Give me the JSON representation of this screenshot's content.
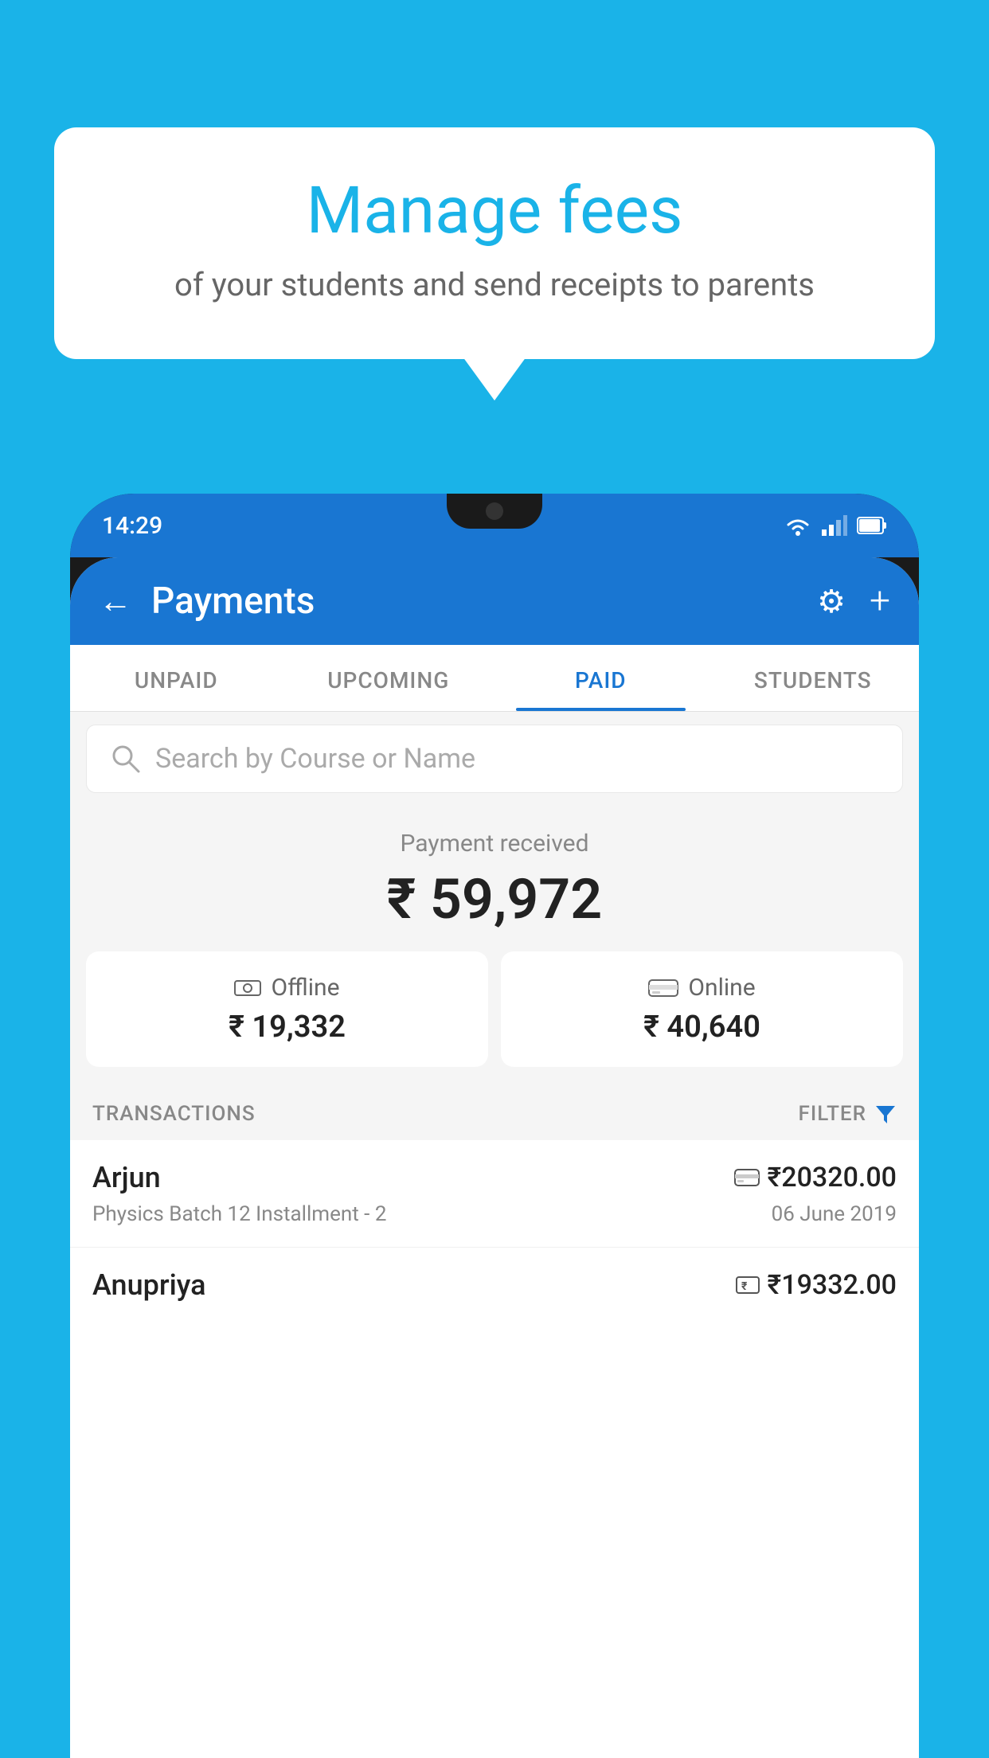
{
  "background_color": "#1ab3e8",
  "speech_bubble": {
    "title": "Manage fees",
    "subtitle": "of your students and send receipts to parents"
  },
  "status_bar": {
    "time": "14:29",
    "icons": [
      "wifi",
      "signal",
      "battery"
    ]
  },
  "header": {
    "title": "Payments",
    "back_label": "←",
    "gear_label": "⚙",
    "plus_label": "+"
  },
  "tabs": [
    {
      "label": "UNPAID",
      "active": false
    },
    {
      "label": "UPCOMING",
      "active": false
    },
    {
      "label": "PAID",
      "active": true
    },
    {
      "label": "STUDENTS",
      "active": false
    }
  ],
  "search": {
    "placeholder": "Search by Course or Name"
  },
  "payment_summary": {
    "label": "Payment received",
    "total": "₹ 59,972",
    "offline_label": "Offline",
    "offline_amount": "₹ 19,332",
    "online_label": "Online",
    "online_amount": "₹ 40,640"
  },
  "transactions": {
    "header_label": "TRANSACTIONS",
    "filter_label": "FILTER",
    "items": [
      {
        "name": "Arjun",
        "type_icon": "card",
        "amount": "₹20320.00",
        "description": "Physics Batch 12 Installment - 2",
        "date": "06 June 2019"
      },
      {
        "name": "Anupriya",
        "type_icon": "cash",
        "amount": "₹19332.00",
        "description": "",
        "date": ""
      }
    ]
  }
}
